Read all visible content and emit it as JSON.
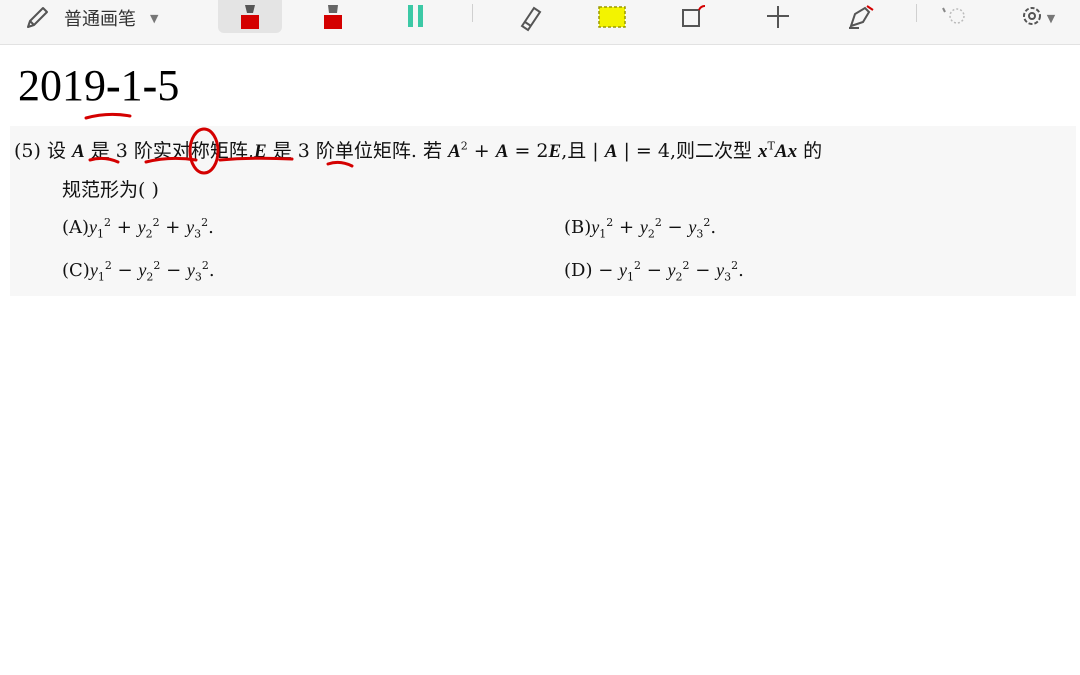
{
  "toolbar": {
    "pen_mode_label": "普通画笔",
    "accent_colors": {
      "marker_red": "#d40000",
      "highlighter_teal": "#3cc9a6",
      "highlighter_yellow": "#f3f300"
    },
    "tools": [
      {
        "name": "pencil-icon"
      },
      {
        "name": "marker-red-icon"
      },
      {
        "name": "marker-red-2-icon"
      },
      {
        "name": "highlighter-teal-icon"
      },
      {
        "name": "eraser-icon"
      },
      {
        "name": "highlight-rect-icon"
      },
      {
        "name": "shape-icon"
      },
      {
        "name": "plus-icon"
      },
      {
        "name": "fountain-pen-icon"
      },
      {
        "name": "lasso-icon"
      },
      {
        "name": "settings-gear-icon"
      }
    ]
  },
  "document": {
    "title_year": "2019",
    "title_dash1": "-",
    "title_part2": "1",
    "title_dash2": "-",
    "title_part3": "5",
    "question": {
      "number": "(5)",
      "line1_a": "设",
      "sym_A": "A",
      "line1_b": "是 3 阶实对称矩阵,",
      "sym_E": "E",
      "line1_c": "是 3 阶单位矩阵. 若",
      "sym_A2": "A",
      "exp_2": "2",
      "line1_d": "+",
      "sym_A3": "A",
      "line1_e": "= 2",
      "sym_E2": "E",
      "line1_f": ",且 |",
      "sym_A4": "A",
      "line1_g": "| = 4,则二次型",
      "sym_x": "x",
      "exp_T": "T",
      "sym_Ax": "Ax",
      "line1_h": "的",
      "line2": "规范形为(         )"
    },
    "options": {
      "A": {
        "label": "(A)",
        "expr": [
          "y",
          "1",
          "2",
          " + ",
          "y",
          "2",
          "2",
          " + ",
          "y",
          "3",
          "2",
          "."
        ]
      },
      "B": {
        "label": "(B)",
        "expr": [
          "y",
          "1",
          "2",
          " + ",
          "y",
          "2",
          "2",
          " − ",
          "y",
          "3",
          "2",
          "."
        ]
      },
      "C": {
        "label": "(C)",
        "expr": [
          "y",
          "1",
          "2",
          " − ",
          "y",
          "2",
          "2",
          " − ",
          "y",
          "3",
          "2",
          "."
        ]
      },
      "D": {
        "label": "(D)",
        "expr": [
          " − ",
          "y",
          "1",
          "2",
          " − ",
          "y",
          "2",
          "2",
          " − ",
          "y",
          "3",
          "2",
          "."
        ]
      }
    }
  }
}
